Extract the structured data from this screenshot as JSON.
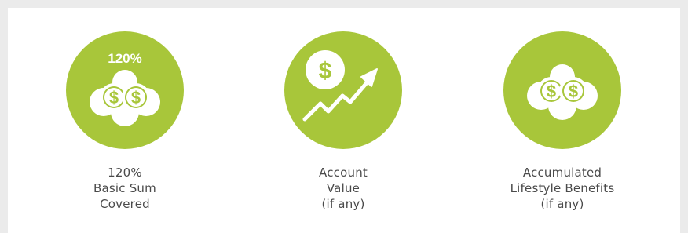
{
  "colors": {
    "accent": "#a8c63a",
    "icon": "#ffffff",
    "text": "#4a4a4a",
    "frame": "#ebebeb"
  },
  "benefits": [
    {
      "icon": "coins-icon",
      "badge": "120%",
      "coin_symbol": "$",
      "caption": [
        "120%",
        "Basic Sum",
        "Covered"
      ]
    },
    {
      "icon": "coin-growth-arrow-icon",
      "coin_symbol": "$",
      "caption": [
        "Account",
        "Value",
        "(if any)"
      ]
    },
    {
      "icon": "coins-icon",
      "coin_symbol": "$",
      "caption": [
        "Accumulated",
        "Lifestyle Benefits",
        "(if any)"
      ]
    }
  ]
}
